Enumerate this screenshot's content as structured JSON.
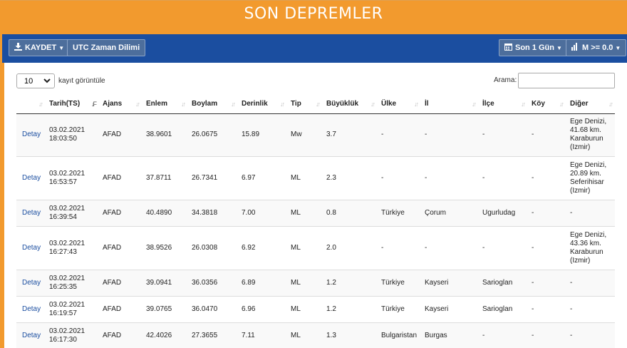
{
  "header": {
    "title": "SON DEPREMLER"
  },
  "toolbar": {
    "save_label": "KAYDET",
    "timezone_label": "UTC Zaman Dilimi",
    "period_label": "Son 1 Gün",
    "magnitude_label": "M >= 0.0"
  },
  "controls": {
    "page_length": "10",
    "page_length_suffix": "kayıt görüntüle",
    "search_label": "Arama:",
    "search_value": ""
  },
  "table": {
    "columns": [
      "",
      "Tarih(TS)",
      "Ajans",
      "Enlem",
      "Boylam",
      "Derinlik",
      "Tip",
      "Büyüklük",
      "Ülke",
      "İl",
      "İlçe",
      "Köy",
      "Diğer"
    ],
    "rows": [
      {
        "link": "Detay",
        "date": "03.02.2021",
        "time": "18:03:50",
        "agency": "AFAD",
        "lat": "38.9601",
        "lon": "26.0675",
        "depth": "15.89",
        "type": "Mw",
        "mag": "3.7",
        "country": "-",
        "province": "-",
        "district": "-",
        "village": "-",
        "other": [
          "Ege Denizi,",
          "41.68 km.",
          "Karaburun",
          "(Izmir)"
        ]
      },
      {
        "link": "Detay",
        "date": "03.02.2021",
        "time": "16:53:57",
        "agency": "AFAD",
        "lat": "37.8711",
        "lon": "26.7341",
        "depth": "6.97",
        "type": "ML",
        "mag": "2.3",
        "country": "-",
        "province": "-",
        "district": "-",
        "village": "-",
        "other": [
          "Ege Denizi,",
          "20.89 km.",
          "Seferihisar",
          "(Izmir)"
        ]
      },
      {
        "link": "Detay",
        "date": "03.02.2021",
        "time": "16:39:54",
        "agency": "AFAD",
        "lat": "40.4890",
        "lon": "34.3818",
        "depth": "7.00",
        "type": "ML",
        "mag": "0.8",
        "country": "Türkiye",
        "province": "Çorum",
        "district": "Ugurludag",
        "village": "-",
        "other": [
          "-"
        ]
      },
      {
        "link": "Detay",
        "date": "03.02.2021",
        "time": "16:27:43",
        "agency": "AFAD",
        "lat": "38.9526",
        "lon": "26.0308",
        "depth": "6.92",
        "type": "ML",
        "mag": "2.0",
        "country": "-",
        "province": "-",
        "district": "-",
        "village": "-",
        "other": [
          "Ege Denizi,",
          "43.36 km.",
          "Karaburun",
          "(Izmir)"
        ]
      },
      {
        "link": "Detay",
        "date": "03.02.2021",
        "time": "16:25:35",
        "agency": "AFAD",
        "lat": "39.0941",
        "lon": "36.0356",
        "depth": "6.89",
        "type": "ML",
        "mag": "1.2",
        "country": "Türkiye",
        "province": "Kayseri",
        "district": "Sarioglan",
        "village": "-",
        "other": [
          "-"
        ]
      },
      {
        "link": "Detay",
        "date": "03.02.2021",
        "time": "16:19:57",
        "agency": "AFAD",
        "lat": "39.0765",
        "lon": "36.0470",
        "depth": "6.96",
        "type": "ML",
        "mag": "1.2",
        "country": "Türkiye",
        "province": "Kayseri",
        "district": "Sarioglan",
        "village": "-",
        "other": [
          "-"
        ]
      },
      {
        "link": "Detay",
        "date": "03.02.2021",
        "time": "16:17:30",
        "agency": "AFAD",
        "lat": "42.4026",
        "lon": "27.3655",
        "depth": "7.11",
        "type": "ML",
        "mag": "1.3",
        "country": "Bulgaristan",
        "province": "Burgas",
        "district": "-",
        "village": "-",
        "other": [
          "-"
        ]
      }
    ]
  },
  "colors": {
    "header": "#f29a2e",
    "toolbar": "#1b4ea0",
    "link": "#1b4ea0"
  }
}
